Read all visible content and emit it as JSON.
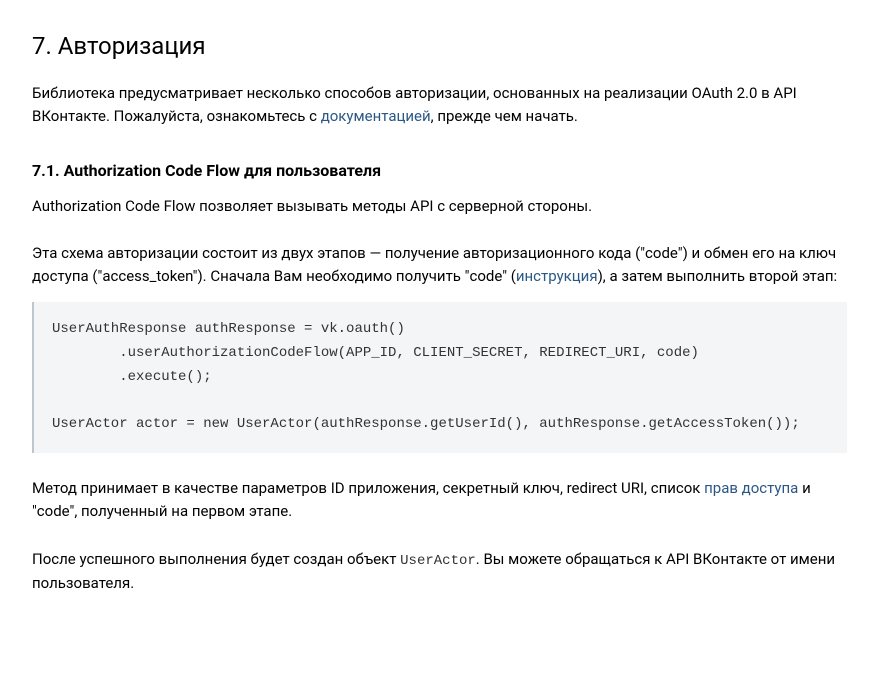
{
  "heading_main": "7. Авторизация",
  "intro": {
    "before_link": "Библиотека предусматривает несколько способов авторизации, основанных на реализации OAuth 2.0 в API ВКонтакте. Пожалуйста, ознакомьтесь с ",
    "link_text": "документацией",
    "after_link": ", прежде чем начать."
  },
  "sub": {
    "heading": "7.1. Authorization Code Flow для пользователя",
    "p1": "Authorization Code Flow позволяет вызывать методы API с серверной стороны.",
    "p2": {
      "before_link": "Эта схема авторизации состоит из двух этапов — получение авторизационного кода (\"code\") и обмен его на ключ доступа (\"access_token\"). Сначала Вам необходимо получить \"code\" (",
      "link_text": "инструкция",
      "after_link": "), а затем выполнить второй этап:"
    },
    "code": "UserAuthResponse authResponse = vk.oauth()\n        .userAuthorizationCodeFlow(APP_ID, CLIENT_SECRET, REDIRECT_URI, code)\n        .execute();\n\nUserActor actor = new UserActor(authResponse.getUserId(), authResponse.getAccessToken());",
    "p3": {
      "before_link": "Метод принимает в качестве параметров ID приложения, секретный ключ, redirect URI, список ",
      "link_text": "прав доступа",
      "after_link": " и \"code\", полученный на первом этапе."
    },
    "p4": {
      "before_code": "После успешного выполнения будет создан объект ",
      "code_text": "UserActor",
      "after_code": ". Вы можете обращаться к API ВКонтакте от имени пользователя."
    }
  }
}
